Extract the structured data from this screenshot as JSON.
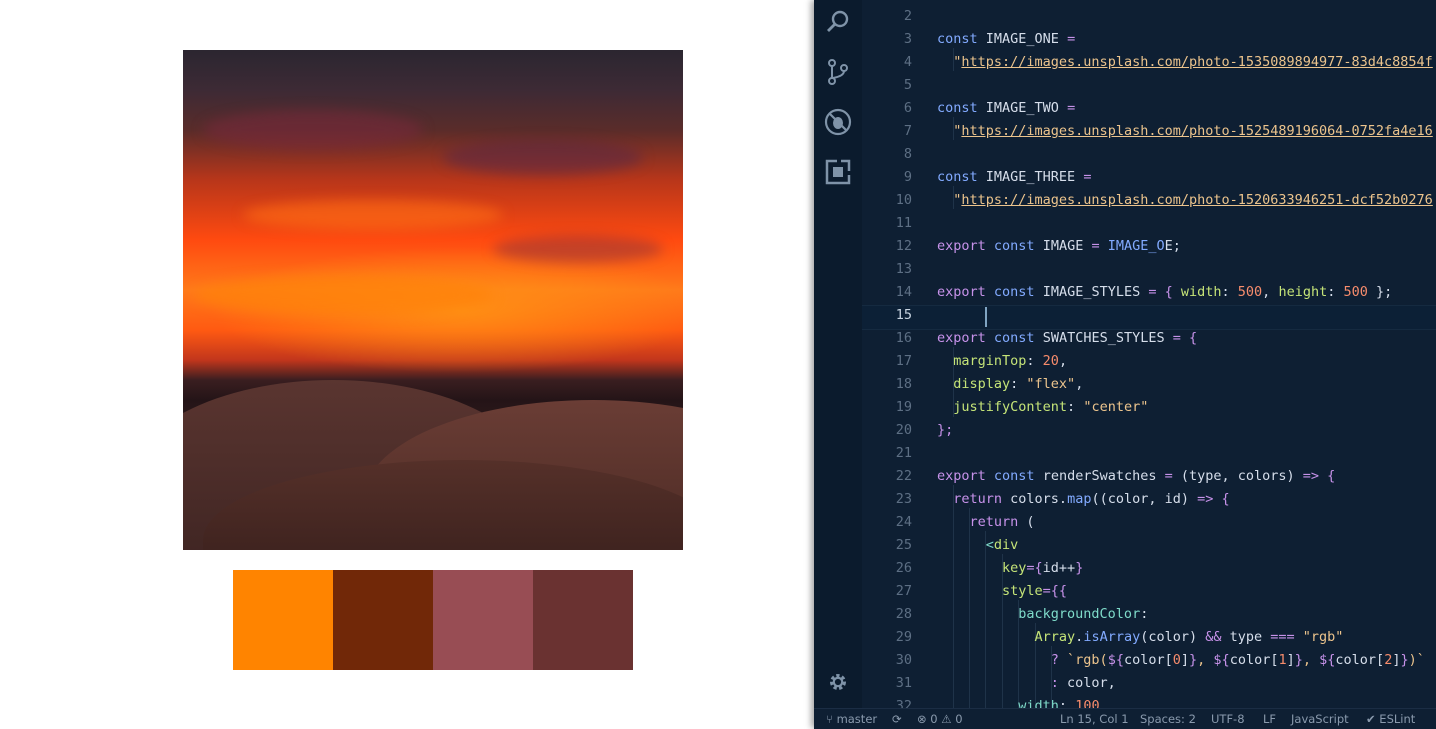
{
  "preview": {
    "swatch_colors": [
      "#ff8400",
      "#712808",
      "#984d54",
      "#6a3231"
    ]
  },
  "activity_bar": {
    "icons": [
      "search-icon",
      "source-control-icon",
      "debug-icon",
      "extensions-icon",
      "settings-gear-icon"
    ]
  },
  "editor": {
    "active_line": 15,
    "lines": [
      {
        "n": "2",
        "segments": []
      },
      {
        "n": "3",
        "segments": [
          {
            "t": "const ",
            "c": "kw"
          },
          {
            "t": "IMAGE_ONE",
            "c": "fn"
          },
          {
            "t": " =",
            "c": "op"
          }
        ]
      },
      {
        "n": "4",
        "segments": [
          {
            "t": "  \"",
            "c": "str"
          },
          {
            "t": "https://images.unsplash.com/photo-1535089894977-83d4c8854f",
            "c": "url"
          }
        ]
      },
      {
        "n": "5",
        "segments": []
      },
      {
        "n": "6",
        "segments": [
          {
            "t": "const ",
            "c": "kw"
          },
          {
            "t": "IMAGE_TWO",
            "c": "fn"
          },
          {
            "t": " =",
            "c": "op"
          }
        ]
      },
      {
        "n": "7",
        "segments": [
          {
            "t": "  \"",
            "c": "str"
          },
          {
            "t": "https://images.unsplash.com/photo-1525489196064-0752fa4e16",
            "c": "url"
          }
        ]
      },
      {
        "n": "8",
        "segments": []
      },
      {
        "n": "9",
        "segments": [
          {
            "t": "const ",
            "c": "kw"
          },
          {
            "t": "IMAGE_THREE",
            "c": "fn"
          },
          {
            "t": " =",
            "c": "op"
          }
        ]
      },
      {
        "n": "10",
        "segments": [
          {
            "t": "  \"",
            "c": "str"
          },
          {
            "t": "https://images.unsplash.com/photo-1520633946251-dcf52b0276",
            "c": "url"
          }
        ]
      },
      {
        "n": "11",
        "segments": []
      },
      {
        "n": "12",
        "segments": [
          {
            "t": "export ",
            "c": "op"
          },
          {
            "t": "const ",
            "c": "kw"
          },
          {
            "t": "IMAGE",
            "c": "fn"
          },
          {
            "t": " = ",
            "c": "op"
          },
          {
            "t": "IMAGE_O",
            "c": "kw"
          },
          {
            "t": "E;",
            "c": "fn"
          }
        ]
      },
      {
        "n": "13",
        "segments": []
      },
      {
        "n": "14",
        "segments": [
          {
            "t": "export ",
            "c": "op"
          },
          {
            "t": "const ",
            "c": "kw"
          },
          {
            "t": "IMAGE_STYLES",
            "c": "fn"
          },
          {
            "t": " = { ",
            "c": "op"
          },
          {
            "t": "width",
            "c": "prop"
          },
          {
            "t": ": ",
            "c": "fn"
          },
          {
            "t": "500",
            "c": "num"
          },
          {
            "t": ", ",
            "c": "fn"
          },
          {
            "t": "height",
            "c": "prop"
          },
          {
            "t": ": ",
            "c": "fn"
          },
          {
            "t": "500",
            "c": "num"
          },
          {
            "t": " };",
            "c": "fn"
          }
        ]
      },
      {
        "n": "15",
        "segments": []
      },
      {
        "n": "16",
        "segments": [
          {
            "t": "export ",
            "c": "op"
          },
          {
            "t": "const ",
            "c": "kw"
          },
          {
            "t": "SWATCHES_STYLES",
            "c": "fn"
          },
          {
            "t": " = {",
            "c": "op"
          }
        ]
      },
      {
        "n": "17",
        "segments": [
          {
            "t": "  marginTop",
            "c": "prop"
          },
          {
            "t": ": ",
            "c": "fn"
          },
          {
            "t": "20",
            "c": "num"
          },
          {
            "t": ",",
            "c": "fn"
          }
        ]
      },
      {
        "n": "18",
        "segments": [
          {
            "t": "  display",
            "c": "prop"
          },
          {
            "t": ": ",
            "c": "fn"
          },
          {
            "t": "\"flex\"",
            "c": "str"
          },
          {
            "t": ",",
            "c": "fn"
          }
        ]
      },
      {
        "n": "19",
        "segments": [
          {
            "t": "  justifyContent",
            "c": "prop"
          },
          {
            "t": ": ",
            "c": "fn"
          },
          {
            "t": "\"center\"",
            "c": "str"
          }
        ]
      },
      {
        "n": "20",
        "segments": [
          {
            "t": "};",
            "c": "op"
          }
        ]
      },
      {
        "n": "21",
        "segments": []
      },
      {
        "n": "22",
        "segments": [
          {
            "t": "export ",
            "c": "op"
          },
          {
            "t": "const ",
            "c": "kw"
          },
          {
            "t": "renderSwatches",
            "c": "fn"
          },
          {
            "t": " = ",
            "c": "op"
          },
          {
            "t": "(type, colors) ",
            "c": "fn"
          },
          {
            "t": "=> {",
            "c": "op"
          }
        ]
      },
      {
        "n": "23",
        "segments": [
          {
            "t": "  return ",
            "c": "op"
          },
          {
            "t": "colors.",
            "c": "fn"
          },
          {
            "t": "map",
            "c": "kw"
          },
          {
            "t": "((color, id) ",
            "c": "fn"
          },
          {
            "t": "=> {",
            "c": "op"
          }
        ]
      },
      {
        "n": "24",
        "segments": [
          {
            "t": "    return ",
            "c": "op"
          },
          {
            "t": "(",
            "c": "fn"
          }
        ]
      },
      {
        "n": "25",
        "segments": [
          {
            "t": "      <",
            "c": "tag"
          },
          {
            "t": "div",
            "c": "prop"
          }
        ]
      },
      {
        "n": "26",
        "segments": [
          {
            "t": "        key",
            "c": "prop"
          },
          {
            "t": "={",
            "c": "op"
          },
          {
            "t": "id++",
            "c": "fn"
          },
          {
            "t": "}",
            "c": "op"
          }
        ]
      },
      {
        "n": "27",
        "segments": [
          {
            "t": "        style",
            "c": "prop"
          },
          {
            "t": "={{",
            "c": "op"
          }
        ]
      },
      {
        "n": "28",
        "segments": [
          {
            "t": "          backgroundColor",
            "c": "tag"
          },
          {
            "t": ":",
            "c": "fn"
          }
        ]
      },
      {
        "n": "29",
        "segments": [
          {
            "t": "            Array",
            "c": "prop"
          },
          {
            "t": ".",
            "c": "fn"
          },
          {
            "t": "isArray",
            "c": "kw"
          },
          {
            "t": "(color) ",
            "c": "fn"
          },
          {
            "t": "&& ",
            "c": "op"
          },
          {
            "t": "type ",
            "c": "fn"
          },
          {
            "t": "=== ",
            "c": "op"
          },
          {
            "t": "\"rgb\"",
            "c": "str"
          }
        ]
      },
      {
        "n": "30",
        "segments": [
          {
            "t": "              ? ",
            "c": "op"
          },
          {
            "t": "`rgb(",
            "c": "str"
          },
          {
            "t": "${",
            "c": "op"
          },
          {
            "t": "color[",
            "c": "fn"
          },
          {
            "t": "0",
            "c": "num"
          },
          {
            "t": "]",
            "c": "fn"
          },
          {
            "t": "}",
            "c": "op"
          },
          {
            "t": ", ",
            "c": "str"
          },
          {
            "t": "${",
            "c": "op"
          },
          {
            "t": "color[",
            "c": "fn"
          },
          {
            "t": "1",
            "c": "num"
          },
          {
            "t": "]",
            "c": "fn"
          },
          {
            "t": "}",
            "c": "op"
          },
          {
            "t": ", ",
            "c": "str"
          },
          {
            "t": "${",
            "c": "op"
          },
          {
            "t": "color[",
            "c": "fn"
          },
          {
            "t": "2",
            "c": "num"
          },
          {
            "t": "]",
            "c": "fn"
          },
          {
            "t": "}",
            "c": "op"
          },
          {
            "t": ")`",
            "c": "str"
          }
        ]
      },
      {
        "n": "31",
        "segments": [
          {
            "t": "              : ",
            "c": "op"
          },
          {
            "t": "color,",
            "c": "fn"
          }
        ]
      },
      {
        "n": "32",
        "segments": [
          {
            "t": "          width",
            "c": "tag"
          },
          {
            "t": ": ",
            "c": "fn"
          },
          {
            "t": "100",
            "c": "num"
          }
        ]
      }
    ]
  },
  "statusbar": {
    "branch": "master",
    "errors": "0",
    "warnings": "0",
    "position": "Ln 15, Col 1",
    "spaces": "Spaces: 2",
    "encoding": "UTF-8",
    "eol": "LF",
    "language": "JavaScript",
    "linter": "ESLint"
  }
}
